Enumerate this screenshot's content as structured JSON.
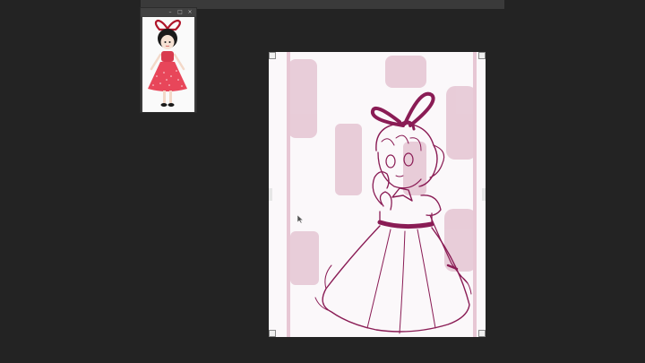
{
  "app": {
    "reference_window": {
      "controls": [
        "minimize-icon",
        "restore-icon",
        "close-icon"
      ],
      "controls_glyphs": [
        "–",
        "□",
        "×"
      ]
    },
    "canvas": {
      "sketch_color": "#8a1c55",
      "underpaint_color": "#d9a9bd"
    },
    "reference_colors": {
      "dress": "#e8465a",
      "ribbon": "#b0152a",
      "hair": "#1a1a1a"
    }
  }
}
